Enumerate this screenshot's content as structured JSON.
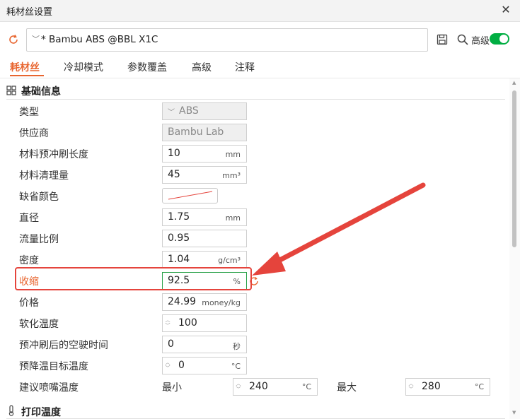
{
  "window": {
    "title": "耗材丝设置",
    "close_glyph": "✕"
  },
  "toolbar": {
    "preset_chevron": "﹀",
    "preset_name": "* Bambu ABS @BBL X1C",
    "advanced_label": "高级",
    "advanced_toggle_on": true
  },
  "tabs": [
    {
      "label": "耗材丝",
      "active": true
    },
    {
      "label": "冷却模式"
    },
    {
      "label": "参数覆盖"
    },
    {
      "label": "高级"
    },
    {
      "label": "注释"
    }
  ],
  "sections": {
    "basic_info": {
      "title": "基础信息"
    },
    "print_temp": {
      "title": "打印温度"
    }
  },
  "fields": {
    "type": {
      "label": "类型",
      "value": "ABS",
      "chevron": "﹀"
    },
    "vendor": {
      "label": "供应商",
      "value": "Bambu Lab"
    },
    "prime_length": {
      "label": "材料预冲刷长度",
      "value": "10",
      "unit": "mm"
    },
    "purge_volume": {
      "label": "材料清理量",
      "value": "45",
      "unit": "mm³"
    },
    "default_color": {
      "label": "缺省颜色"
    },
    "diameter": {
      "label": "直径",
      "value": "1.75",
      "unit": "mm"
    },
    "flow_ratio": {
      "label": "流量比例",
      "value": "0.95"
    },
    "density": {
      "label": "密度",
      "value": "1.04",
      "unit": "g/cm³"
    },
    "shrinkage": {
      "label": "收缩",
      "value": "92.5",
      "unit": "%"
    },
    "price": {
      "label": "价格",
      "value": "24.99",
      "unit": "money/kg"
    },
    "softening_temp": {
      "label": "软化温度",
      "value": "100"
    },
    "travel_time_after_prime": {
      "label": "预冲刷后的空驶时间",
      "value": "0",
      "unit": "秒"
    },
    "cooldown_target_temp": {
      "label": "预降温目标温度",
      "value": "0",
      "unit": "°C"
    },
    "nozzle_temp_range": {
      "label": "建议喷嘴温度",
      "min_label": "最小",
      "min_value": "240",
      "min_unit": "°C",
      "max_label": "最大",
      "max_value": "280",
      "max_unit": "°C"
    }
  },
  "colors": {
    "accent": "#e8652f",
    "toggle": "#00ae42",
    "annotation": "#e5443c",
    "modified_border": "#2aa24a"
  }
}
